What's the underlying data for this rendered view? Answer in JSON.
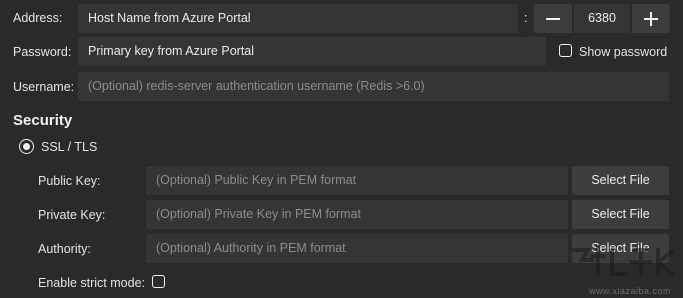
{
  "address": {
    "label": "Address:",
    "host_placeholder": "Host Name from Azure Portal",
    "port_separator": ":",
    "port_value": "6380",
    "decrement_symbol": "—",
    "increment_symbol": "+"
  },
  "password": {
    "label": "Password:",
    "placeholder": "Primary key from Azure Portal",
    "show_label": "Show password",
    "show_checked": false
  },
  "username": {
    "label": "Username:",
    "placeholder": "(Optional) redis-server authentication username (Redis >6.0)"
  },
  "security": {
    "title": "Security",
    "ssl_label": "SSL / TLS",
    "ssl_selected": true,
    "public_key": {
      "label": "Public Key:",
      "placeholder": "(Optional) Public Key in PEM format",
      "button": "Select File"
    },
    "private_key": {
      "label": "Private Key:",
      "placeholder": "(Optional) Private Key in PEM format",
      "button": "Select File"
    },
    "authority": {
      "label": "Authority:",
      "placeholder": "(Optional) Authority in PEM format",
      "button": "Select File"
    },
    "strict_mode": {
      "label": "Enable strict mode:",
      "checked": false
    }
  },
  "watermark": {
    "text": "www.xiazaiba.com",
    "icon_name": "download-site-watermark-icon"
  }
}
